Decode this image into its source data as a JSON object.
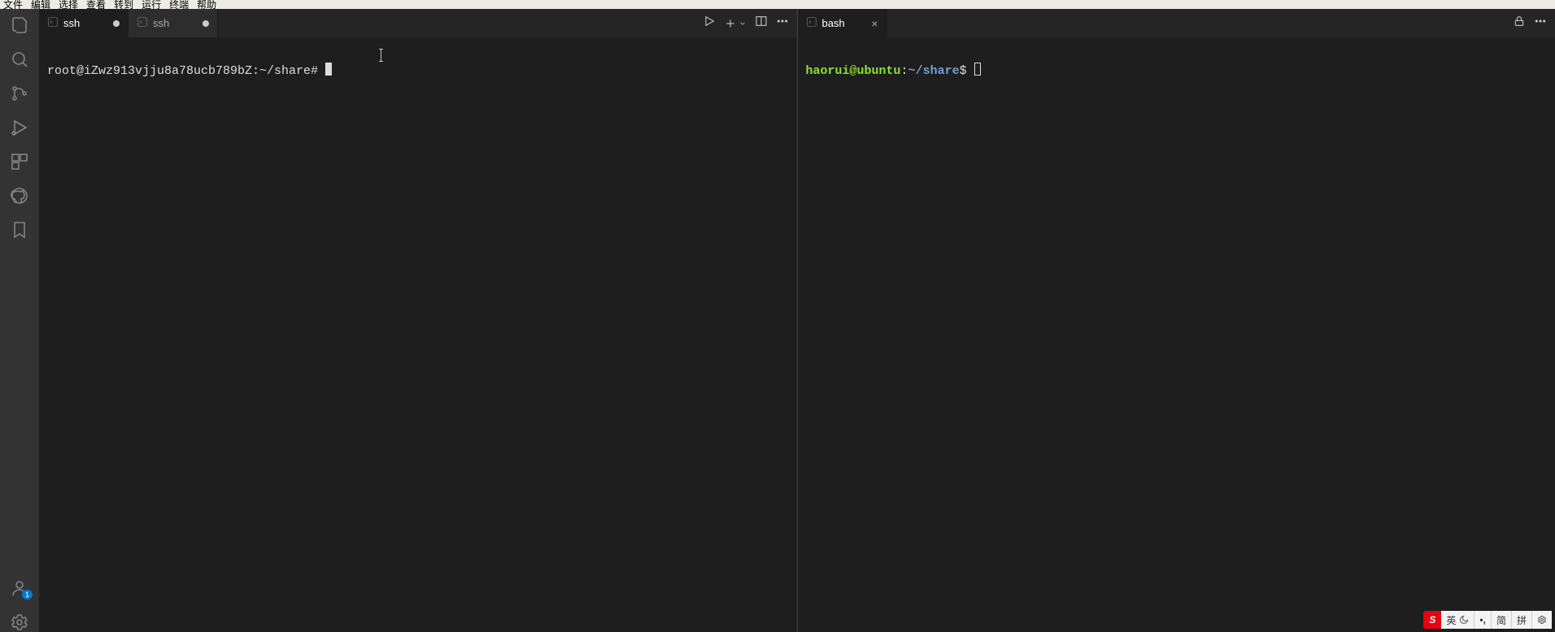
{
  "menu": [
    "文件",
    "编辑",
    "选择",
    "查看",
    "转到",
    "运行",
    "终端",
    "帮助"
  ],
  "activity": {
    "account_badge": "1"
  },
  "left_group": {
    "tabs": [
      {
        "label": "ssh",
        "active": true,
        "dirty": true
      },
      {
        "label": "ssh",
        "active": false,
        "dirty": true
      }
    ],
    "prompt": "root@iZwz913vjju8a78ucb789bZ:~/share# "
  },
  "right_group": {
    "tabs": [
      {
        "label": "bash",
        "active": true,
        "dirty": false
      }
    ],
    "prompt": {
      "user": "haorui",
      "at": "@",
      "host": "ubuntu",
      "colon": ":",
      "tilde": "~",
      "path": "/share",
      "dollar": "$ "
    }
  },
  "ime": {
    "lang": "英",
    "mode": "简",
    "type": "拼"
  }
}
